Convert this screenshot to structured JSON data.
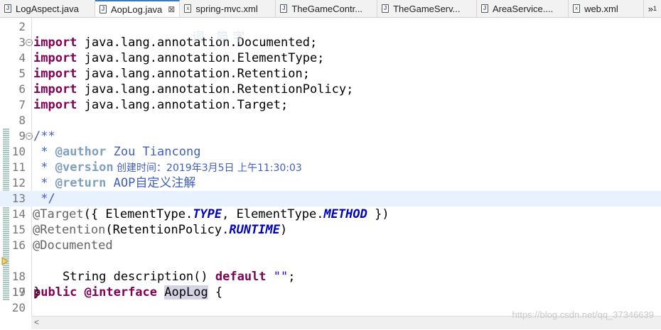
{
  "tabs": [
    {
      "label": "LogAspect.java",
      "icon": "java-file-icon",
      "active": false
    },
    {
      "label": "AopLog.java",
      "icon": "java-file-icon",
      "active": true
    },
    {
      "label": "spring-mvc.xml",
      "icon": "xml-file-icon",
      "active": false
    },
    {
      "label": "TheGameContr...",
      "icon": "java-file-icon",
      "active": false
    },
    {
      "label": "TheGameServ...",
      "icon": "java-file-icon",
      "active": false
    },
    {
      "label": "AreaService....",
      "icon": "java-file-icon",
      "active": false
    },
    {
      "label": "web.xml",
      "icon": "xml-file-icon",
      "active": false
    }
  ],
  "overflow_label": "»",
  "overflow_count": "1",
  "lines": [
    "2",
    "3",
    "4",
    "5",
    "6",
    "7",
    "8",
    "9",
    "10",
    "11",
    "12",
    "13",
    "14",
    "15",
    "16",
    "17",
    "18",
    "19",
    "20"
  ],
  "code": {
    "import_kw": "import",
    "imports": [
      " java.lang.annotation.Documented;",
      " java.lang.annotation.ElementType;",
      " java.lang.annotation.Retention;",
      " java.lang.annotation.RetentionPolicy;",
      " java.lang.annotation.Target;"
    ],
    "doc_open": "/**",
    "doc_author_prefix": " * ",
    "author_tag": "@author",
    "author_value": " Zou Tiancong",
    "version_tag": "@version",
    "version_value": " 创建时间：2019年3月5日 上午11:30:03",
    "return_tag": "@return",
    "return_value": " AOP自定义注解",
    "doc_close": " */",
    "target_ann": "@Target",
    "target_open": "({ ElementType.",
    "target_type": "TYPE",
    "target_mid": ", ElementType.",
    "target_method": "METHOD",
    "target_close": " })",
    "retention_ann": "@Retention",
    "retention_open": "(RetentionPolicy.",
    "retention_runtime": "RUNTIME",
    "retention_close": ")",
    "documented_ann": "@Documented",
    "public_kw": "public",
    "interface_kw": " @interface",
    "class_name": "AopLog",
    "brace_open": " {",
    "method_indent": "    String description() ",
    "default_kw": "default",
    "default_value": " \"\"",
    "semicolon": ";",
    "brace_close": "}"
  },
  "watermark": "https://blog.csdn.net/qq_37346639",
  "faint_overlay": "词 简字",
  "colors": {
    "keyword": "#7f0055",
    "javadoc": "#3f5fbf",
    "annotation": "#646464",
    "constant": "#0000c0",
    "string": "#2a00ff"
  }
}
